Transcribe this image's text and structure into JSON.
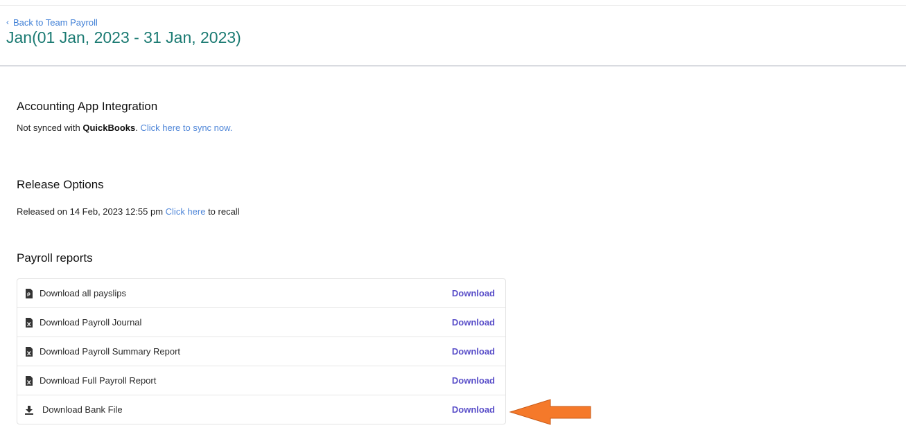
{
  "header": {
    "back_label": "Back to Team Payroll",
    "title": "Jan(01 Jan, 2023 - 31 Jan, 2023)"
  },
  "accounting": {
    "title": "Accounting App Integration",
    "status_prefix": "Not synced with ",
    "app_name": "QuickBooks",
    "status_suffix": ". ",
    "sync_link": "Click here to sync now."
  },
  "release": {
    "title": "Release Options",
    "prefix": "Released on 14 Feb, 2023 12:55 pm ",
    "link": "Click here",
    "suffix": " to recall"
  },
  "reports": {
    "title": "Payroll reports",
    "items": [
      {
        "label": "Download all payslips",
        "action": "Download",
        "icon": "pdf-file-icon"
      },
      {
        "label": "Download Payroll Journal",
        "action": "Download",
        "icon": "excel-file-icon"
      },
      {
        "label": "Download Payroll Summary Report",
        "action": "Download",
        "icon": "excel-file-icon"
      },
      {
        "label": "Download Full Payroll Report",
        "action": "Download",
        "icon": "excel-file-icon"
      },
      {
        "label": "Download Bank File",
        "action": "Download",
        "icon": "download-icon"
      }
    ]
  },
  "colors": {
    "title_teal": "#1a7a72",
    "link_blue": "#4f86d8",
    "download_purple": "#5a4fc9",
    "arrow_orange": "#f5792a"
  }
}
